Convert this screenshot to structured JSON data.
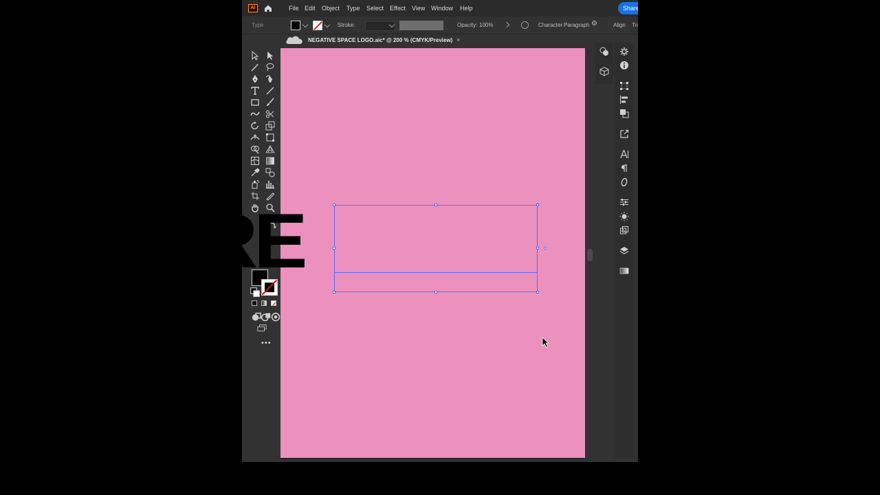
{
  "app": {
    "logo": "Ai",
    "menu": [
      "File",
      "Edit",
      "Object",
      "Type",
      "Select",
      "Effect",
      "View",
      "Window",
      "Help"
    ],
    "share_label": "Share"
  },
  "control_bar": {
    "selection_type": "Type",
    "stroke_label": "Stroke:",
    "opacity_label": "Opacity:",
    "opacity_value": "100%",
    "character_label": "Character",
    "paragraph_label": "Paragraph",
    "align_label": "Align",
    "transform_label": "Tra"
  },
  "document_tab": {
    "title": "NEGATIVE SPACE LOGO.aic* @ 200 % (CMYK/Preview)",
    "close_glyph": "×"
  },
  "artboard": {
    "background_color": "#ec90bd",
    "text": "YORE",
    "text_color": "#000000"
  },
  "toolbar": {
    "fill_color": "#000000",
    "stroke_color": "none",
    "more_glyph": "•••"
  }
}
